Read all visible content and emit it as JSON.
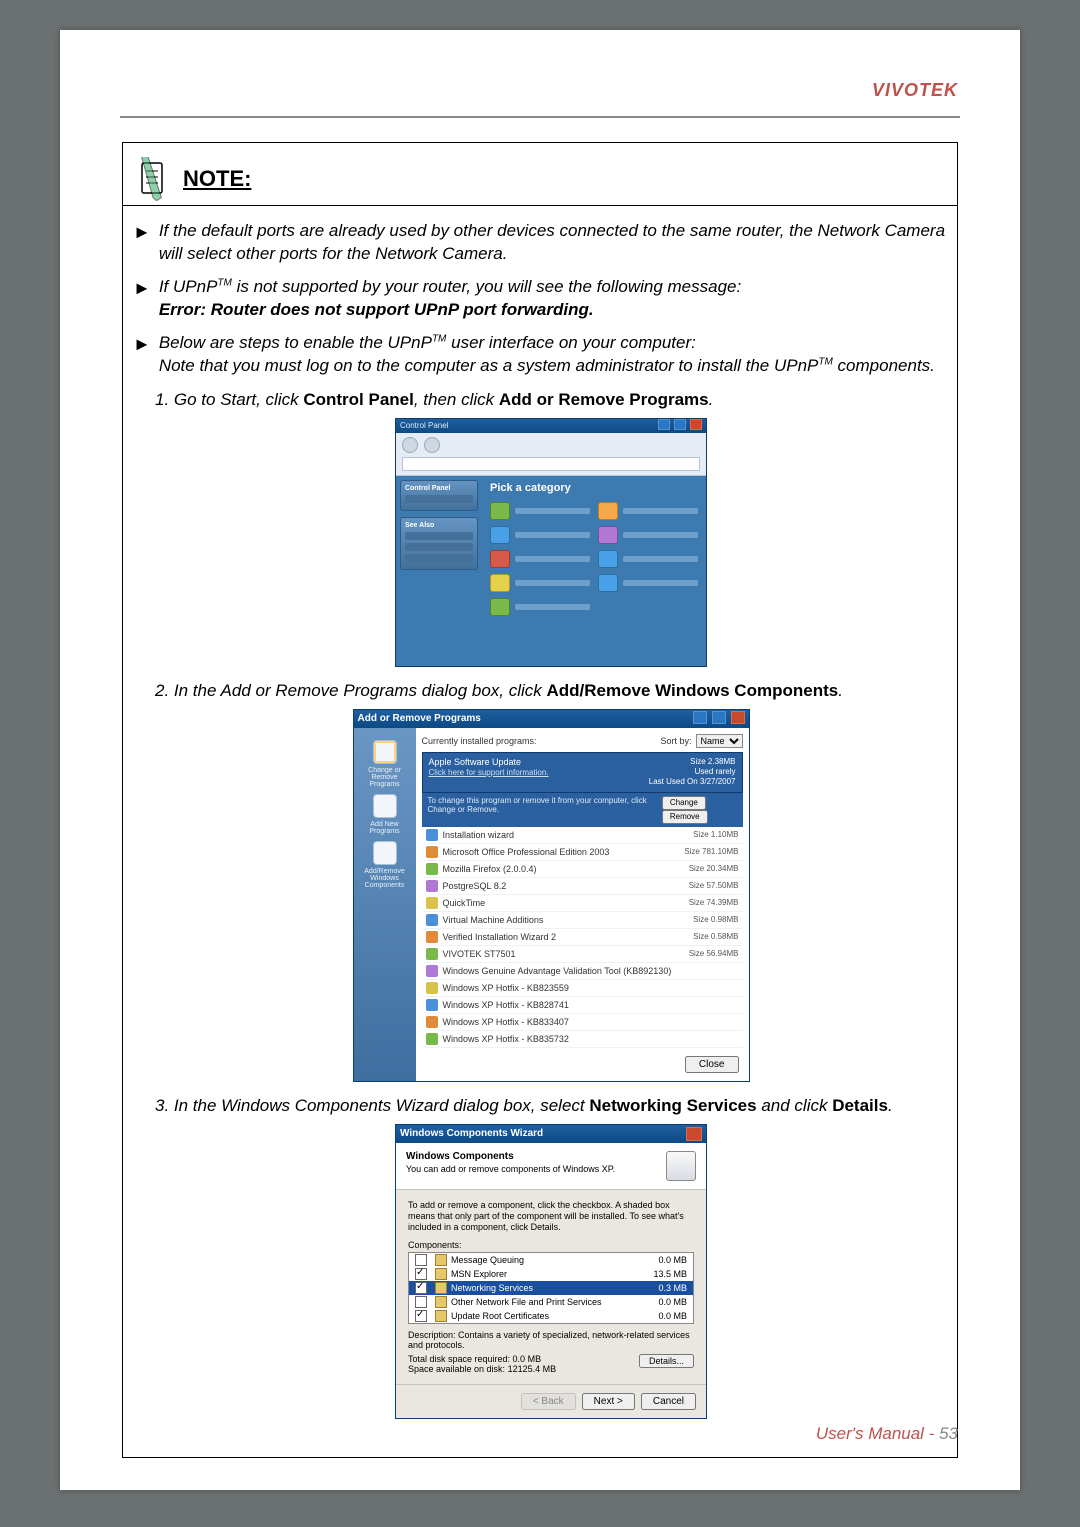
{
  "brand": "VIVOTEK",
  "note_heading": "NOTE:",
  "bullets": {
    "b1": "If the default ports are already used by other devices connected to the same router, the Network Camera will select other ports for the Network Camera.",
    "b2a": "If UPnP",
    "b2tm": "TM",
    "b2b": " is not supported by your router, you will see the following message:",
    "b2err": "Error: Router does not support UPnP port forwarding.",
    "b3a": "Below are steps to enable the UPnP",
    "b3b": " user interface on your computer:",
    "b3note_a": "Note that you must log on to the computer as a system administrator to install the UPnP",
    "b3note_b": " components."
  },
  "steps": {
    "s1a": "1. Go to Start, click ",
    "s1b": "Control Panel",
    "s1c": ", then click ",
    "s1d": "Add or Remove Programs",
    "s1e": ".",
    "s2a": "2. In the Add or Remove Programs dialog box, click ",
    "s2b": "Add/Remove Windows Components",
    "s2c": ".",
    "s3a": "3. In the Windows Components Wizard dialog box, select ",
    "s3b": "Networking Services",
    "s3c": " and click ",
    "s3d": "Details",
    "s3e": "."
  },
  "shot1": {
    "title": "Control Panel",
    "pick": "Pick a category"
  },
  "shot2": {
    "title": "Add or Remove Programs",
    "currently": "Currently installed programs:",
    "sortby": "Sort by:",
    "sortval": "Name",
    "side": {
      "a": "Change or Remove Programs",
      "b": "Add New Programs",
      "c": "Add/Remove Windows Components"
    },
    "hl_name": "Apple Software Update",
    "hl_link": "Click here for support information.",
    "hl_size": "Size    2.38MB",
    "hl_used": "Used    rarely",
    "hl_last": "Last Used On  3/27/2007",
    "hint": "To change this program or remove it from your computer, click Change or Remove.",
    "btn_change": "Change",
    "btn_remove": "Remove",
    "rows": [
      {
        "n": "Installation wizard",
        "s": "Size    1.10MB"
      },
      {
        "n": "Microsoft Office Professional Edition 2003",
        "s": "Size  781.10MB"
      },
      {
        "n": "Mozilla Firefox (2.0.0.4)",
        "s": "Size   20.34MB"
      },
      {
        "n": "PostgreSQL 8.2",
        "s": "Size   57.50MB"
      },
      {
        "n": "QuickTime",
        "s": "Size   74.39MB"
      },
      {
        "n": "Virtual Machine Additions",
        "s": "Size    0.98MB"
      },
      {
        "n": "Verified Installation Wizard 2",
        "s": "Size    0.58MB"
      },
      {
        "n": "VIVOTEK ST7501",
        "s": "Size   56.94MB"
      },
      {
        "n": "Windows Genuine Advantage Validation Tool (KB892130)",
        "s": ""
      },
      {
        "n": "Windows XP Hotfix - KB823559",
        "s": ""
      },
      {
        "n": "Windows XP Hotfix - KB828741",
        "s": ""
      },
      {
        "n": "Windows XP Hotfix - KB833407",
        "s": ""
      },
      {
        "n": "Windows XP Hotfix - KB835732",
        "s": ""
      }
    ],
    "close": "Close"
  },
  "shot3": {
    "title": "Windows Components Wizard",
    "head_t": "Windows Components",
    "head_d": "You can add or remove components of Windows XP.",
    "intro": "To add or remove a component, click the checkbox. A shaded box means that only part of the component will be installed. To see what's included in a component, click Details.",
    "label": "Components:",
    "rows": [
      {
        "n": "Message Queuing",
        "s": "0.0 MB",
        "chk": false
      },
      {
        "n": "MSN Explorer",
        "s": "13.5 MB",
        "chk": true
      },
      {
        "n": "Networking Services",
        "s": "0.3 MB",
        "chk": true,
        "active": true
      },
      {
        "n": "Other Network File and Print Services",
        "s": "0.0 MB",
        "chk": false
      },
      {
        "n": "Update Root Certificates",
        "s": "0.0 MB",
        "chk": true
      }
    ],
    "desc": "Description:  Contains a variety of specialized, network-related services and protocols.",
    "req": "Total disk space required:            0.0 MB",
    "avail": "Space available on disk:        12125.4 MB",
    "details": "Details...",
    "back": "< Back",
    "next": "Next >",
    "cancel": "Cancel"
  },
  "footer": {
    "label": "User's Manual - ",
    "page": "53"
  }
}
